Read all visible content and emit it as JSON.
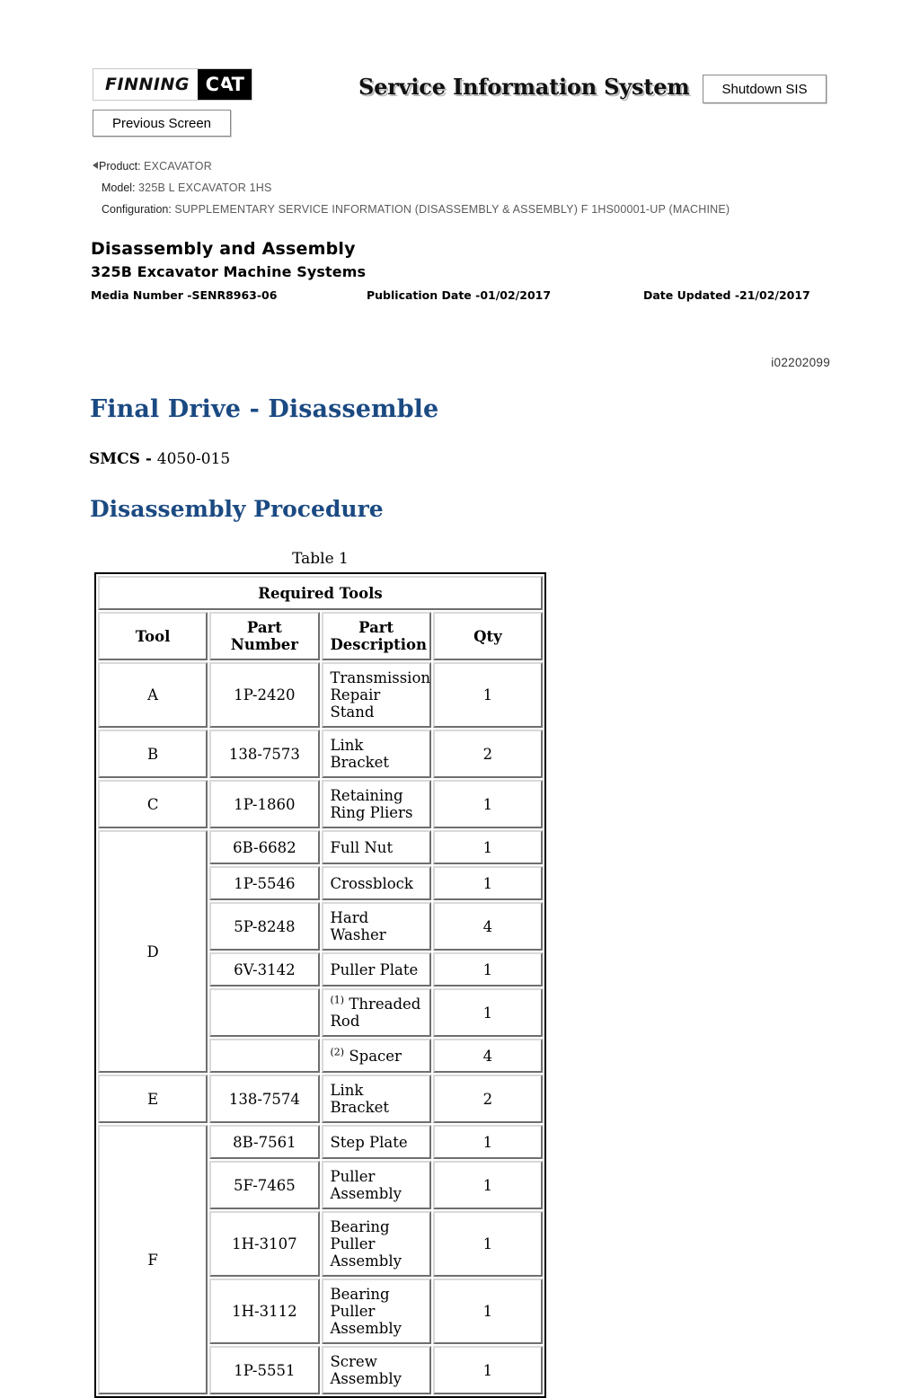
{
  "header": {
    "logo_finning": "FINNING",
    "logo_cat": "CAT",
    "app_title": "Service Information System",
    "shutdown_label": "Shutdown SIS",
    "previous_label": "Previous Screen"
  },
  "meta": {
    "product_label": "Product:",
    "product_value": "EXCAVATOR",
    "model_label": "Model:",
    "model_value": "325B L EXCAVATOR 1HS",
    "configuration_label": "Configuration:",
    "configuration_value": "SUPPLEMENTARY SERVICE INFORMATION (DISASSEMBLY & ASSEMBLY) F 1HS00001-UP (MACHINE)"
  },
  "document": {
    "title": "Disassembly and Assembly",
    "subtitle": "325B Excavator Machine Systems",
    "media_number": "Media Number -SENR8963-06",
    "publication_date": "Publication Date -01/02/2017",
    "date_updated": "Date Updated -21/02/2017",
    "doc_id": "i02202099"
  },
  "content": {
    "heading": "Final Drive - Disassemble",
    "smcs_label": "SMCS - ",
    "smcs_value": "4050-015",
    "subheading": "Disassembly Procedure",
    "table_caption": "Table 1"
  },
  "table": {
    "title": "Required Tools",
    "columns": [
      "Tool",
      "Part Number",
      "Part Description",
      "Qty"
    ],
    "rows": [
      {
        "tool": "A",
        "part_number": "1P-2420",
        "description": "Transmission Repair Stand",
        "qty": "1",
        "footnote": ""
      },
      {
        "tool": "B",
        "part_number": "138-7573",
        "description": "Link Bracket",
        "qty": "2",
        "footnote": ""
      },
      {
        "tool": "C",
        "part_number": "1P-1860",
        "description": "Retaining Ring Pliers",
        "qty": "1",
        "footnote": ""
      },
      {
        "tool": "D",
        "part_number": "6B-6682",
        "description": "Full Nut",
        "qty": "1",
        "footnote": ""
      },
      {
        "tool": "",
        "part_number": "1P-5546",
        "description": "Crossblock",
        "qty": "1",
        "footnote": ""
      },
      {
        "tool": "",
        "part_number": "5P-8248",
        "description": "Hard Washer",
        "qty": "4",
        "footnote": ""
      },
      {
        "tool": "",
        "part_number": "6V-3142",
        "description": "Puller Plate",
        "qty": "1",
        "footnote": ""
      },
      {
        "tool": "",
        "part_number": "",
        "description": "Threaded Rod",
        "qty": "1",
        "footnote": "(1)"
      },
      {
        "tool": "",
        "part_number": "",
        "description": "Spacer",
        "qty": "4",
        "footnote": "(2)"
      },
      {
        "tool": "E",
        "part_number": "138-7574",
        "description": "Link Bracket",
        "qty": "2",
        "footnote": ""
      },
      {
        "tool": "F",
        "part_number": "8B-7561",
        "description": "Step Plate",
        "qty": "1",
        "footnote": ""
      },
      {
        "tool": "",
        "part_number": "5F-7465",
        "description": "Puller Assembly",
        "qty": "1",
        "footnote": ""
      },
      {
        "tool": "",
        "part_number": "1H-3107",
        "description": "Bearing Puller Assembly",
        "qty": "1",
        "footnote": ""
      },
      {
        "tool": "",
        "part_number": "1H-3112",
        "description": "Bearing Puller Assembly",
        "qty": "1",
        "footnote": ""
      },
      {
        "tool": "",
        "part_number": "1P-5551",
        "description": "Screw Assembly",
        "qty": "1",
        "footnote": ""
      }
    ],
    "tool_group_rows": {
      "D": 4,
      "F": 11
    }
  }
}
